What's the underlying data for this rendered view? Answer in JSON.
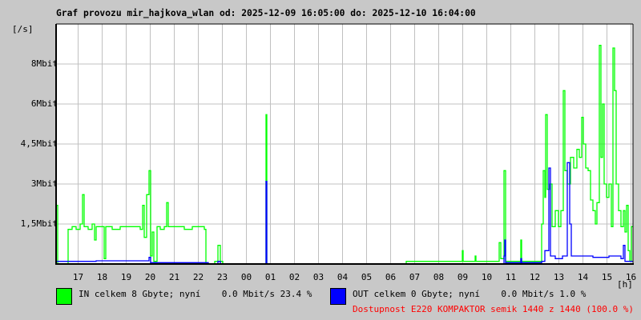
{
  "title": "Graf provozu mir_hajkova_wlan od: 2025-12-09 16:05:00 do: 2025-12-10 16:04:00",
  "chart_data": {
    "type": "line",
    "title": "Graf provozu mir_hajkova_wlan od: 2025-12-09 16:05:00 do: 2025-12-10 16:04:00",
    "ylabel": "[/s]",
    "xlabel": "[h]",
    "x_unit": "minutes since 2025-12-09 16:05",
    "ylim_mbit": [
      0,
      9
    ],
    "y_ticks": [
      {
        "value": 1.5,
        "label": "1,5Mbit"
      },
      {
        "value": 3,
        "label": "3Mbit"
      },
      {
        "value": 4.5,
        "label": "4,5Mbit"
      },
      {
        "value": 6,
        "label": "6Mbit"
      },
      {
        "value": 7.5,
        "label": "8Mbit"
      }
    ],
    "x_ticks": [
      "17",
      "18",
      "19",
      "20",
      "21",
      "22",
      "23",
      "00",
      "01",
      "02",
      "03",
      "04",
      "05",
      "06",
      "07",
      "08",
      "09",
      "10",
      "11",
      "12",
      "13",
      "14",
      "15",
      "16"
    ],
    "grid": true,
    "series": [
      {
        "name": "IN",
        "color": "#00ff00",
        "points": [
          [
            0,
            2.2
          ],
          [
            4,
            0
          ],
          [
            30,
            1.3
          ],
          [
            40,
            1.4
          ],
          [
            50,
            1.3
          ],
          [
            60,
            1.5
          ],
          [
            66,
            2.6
          ],
          [
            70,
            1.4
          ],
          [
            80,
            1.3
          ],
          [
            90,
            1.5
          ],
          [
            96,
            0.9
          ],
          [
            100,
            1.4
          ],
          [
            110,
            1.4
          ],
          [
            120,
            0.2
          ],
          [
            124,
            1.4
          ],
          [
            140,
            1.3
          ],
          [
            160,
            1.4
          ],
          [
            180,
            1.4
          ],
          [
            200,
            1.4
          ],
          [
            210,
            1.3
          ],
          [
            216,
            2.2
          ],
          [
            220,
            1.0
          ],
          [
            226,
            2.6
          ],
          [
            232,
            3.5
          ],
          [
            236,
            0.3
          ],
          [
            240,
            1.2
          ],
          [
            244,
            0.1
          ],
          [
            252,
            1.4
          ],
          [
            260,
            1.3
          ],
          [
            270,
            1.4
          ],
          [
            276,
            2.3
          ],
          [
            280,
            1.4
          ],
          [
            300,
            1.4
          ],
          [
            320,
            1.3
          ],
          [
            340,
            1.4
          ],
          [
            360,
            1.4
          ],
          [
            370,
            1.3
          ],
          [
            374,
            0
          ],
          [
            396,
            0.1
          ],
          [
            404,
            0.7
          ],
          [
            410,
            0.1
          ],
          [
            416,
            0
          ],
          [
            522,
            0
          ],
          [
            524,
            5.6
          ],
          [
            526,
            0
          ],
          [
            870,
            0
          ],
          [
            874,
            0.1
          ],
          [
            940,
            0.1
          ],
          [
            1014,
            0.5
          ],
          [
            1016,
            0.1
          ],
          [
            1046,
            0.3
          ],
          [
            1048,
            0.1
          ],
          [
            1100,
            0.1
          ],
          [
            1106,
            0.8
          ],
          [
            1110,
            0.2
          ],
          [
            1118,
            3.5
          ],
          [
            1122,
            0.1
          ],
          [
            1140,
            0.1
          ],
          [
            1160,
            0.9
          ],
          [
            1162,
            0.1
          ],
          [
            1206,
            0.1
          ],
          [
            1212,
            1.5
          ],
          [
            1216,
            3.5
          ],
          [
            1220,
            2.5
          ],
          [
            1222,
            5.6
          ],
          [
            1226,
            2.8
          ],
          [
            1232,
            3.0
          ],
          [
            1238,
            1.4
          ],
          [
            1246,
            2.0
          ],
          [
            1254,
            1.4
          ],
          [
            1260,
            2.0
          ],
          [
            1266,
            6.5
          ],
          [
            1270,
            3.5
          ],
          [
            1276,
            3.0
          ],
          [
            1284,
            4.0
          ],
          [
            1292,
            3.6
          ],
          [
            1300,
            4.3
          ],
          [
            1306,
            4.0
          ],
          [
            1312,
            5.5
          ],
          [
            1316,
            4.5
          ],
          [
            1322,
            3.6
          ],
          [
            1328,
            3.5
          ],
          [
            1334,
            2.4
          ],
          [
            1340,
            2.0
          ],
          [
            1346,
            1.5
          ],
          [
            1350,
            2.3
          ],
          [
            1356,
            8.2
          ],
          [
            1360,
            4.0
          ],
          [
            1364,
            6.0
          ],
          [
            1368,
            3.0
          ],
          [
            1374,
            2.5
          ],
          [
            1380,
            3.0
          ],
          [
            1386,
            1.4
          ],
          [
            1390,
            8.1
          ],
          [
            1394,
            6.5
          ],
          [
            1398,
            3.0
          ],
          [
            1404,
            2.0
          ],
          [
            1410,
            1.4
          ],
          [
            1416,
            2.0
          ],
          [
            1420,
            1.2
          ],
          [
            1424,
            2.2
          ],
          [
            1428,
            0.5
          ],
          [
            1432,
            0.1
          ],
          [
            1436,
            1.4
          ]
        ]
      },
      {
        "name": "OUT",
        "color": "#0000ff",
        "points": [
          [
            0,
            0.1
          ],
          [
            10,
            0.1
          ],
          [
            100,
            0.12
          ],
          [
            232,
            0.25
          ],
          [
            236,
            0.05
          ],
          [
            374,
            0.05
          ],
          [
            380,
            0
          ],
          [
            404,
            0.1
          ],
          [
            410,
            0
          ],
          [
            522,
            0
          ],
          [
            524,
            3.1
          ],
          [
            526,
            0
          ],
          [
            1118,
            0.3
          ],
          [
            1120,
            0.9
          ],
          [
            1122,
            0.05
          ],
          [
            1160,
            0.2
          ],
          [
            1162,
            0.05
          ],
          [
            1212,
            0.1
          ],
          [
            1220,
            0.5
          ],
          [
            1230,
            3.6
          ],
          [
            1234,
            0.3
          ],
          [
            1246,
            0.2
          ],
          [
            1264,
            0.3
          ],
          [
            1276,
            3.8
          ],
          [
            1282,
            1.5
          ],
          [
            1286,
            0.3
          ],
          [
            1300,
            0.3
          ],
          [
            1340,
            0.25
          ],
          [
            1380,
            0.3
          ],
          [
            1410,
            0.2
          ],
          [
            1416,
            0.7
          ],
          [
            1420,
            0.1
          ],
          [
            1436,
            0.1
          ]
        ]
      }
    ]
  },
  "legend": {
    "in_text": "IN celkem 8 Gbyte; nyní    0.0 Mbit/s 23.4 %",
    "in_color": "#00ff00",
    "out_text": "OUT celkem 0 Gbyte; nyní    0.0 Mbit/s 1.0 %",
    "out_color": "#0000ff",
    "availability": "Dostupnost E220 KOMPAKTOR semik 1440 z 1440 (100.0 %)"
  }
}
